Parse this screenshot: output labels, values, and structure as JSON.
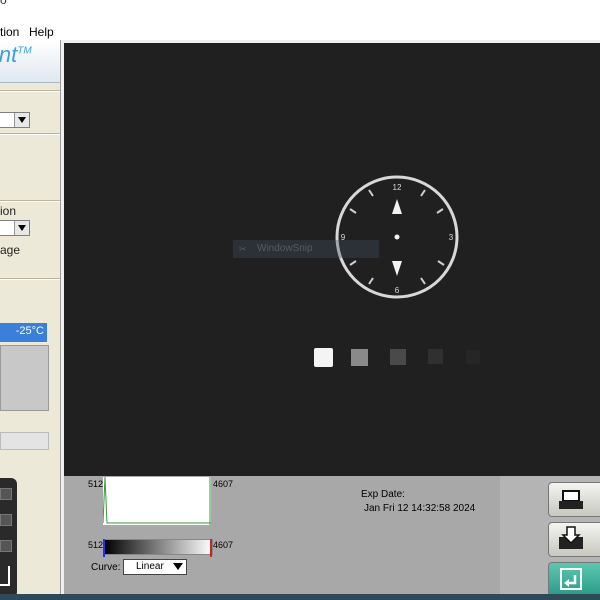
{
  "window": {
    "title_partial": "o"
  },
  "menu": {
    "items": [
      "tion",
      "Help"
    ]
  },
  "left_panel": {
    "logo_text": "int",
    "logo_tm": "TM",
    "label_ion": "ion",
    "label_age": "age",
    "temperature": "-25°C"
  },
  "image": {
    "clock_numbers": {
      "n12": "12",
      "n3": "3",
      "n6": "6",
      "n9": "9"
    },
    "ghost_label": "WindowSnip"
  },
  "histogram": {
    "min_label": "512",
    "max_label": "4607",
    "grad_min_label": "512",
    "grad_max_label": "4607",
    "curve_label": "Curve:",
    "curve_value": "Linear"
  },
  "exposure": {
    "label": "Exp Date:",
    "value": "Jan Fri 12 14:32:58 2024"
  },
  "icons": {
    "print": "printer-icon",
    "save": "save-icon",
    "return": "return-icon",
    "camera": "camera-icon"
  },
  "colors": {
    "accent": "#3a7fd9",
    "logo": "#3aa0e0",
    "image_bg": "#202020"
  }
}
